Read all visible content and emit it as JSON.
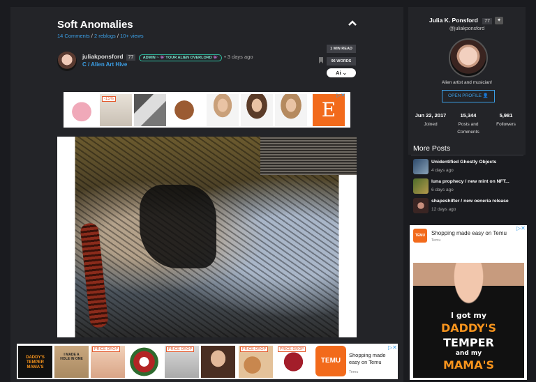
{
  "post": {
    "title": "Soft Anomalies",
    "comments": "14 Comments",
    "reblogs": "2 reblogs",
    "views": "10+ views",
    "author": "juliakponsford",
    "author_level": "77",
    "admin_badge": "ADMIN ~ 👾 YOUR ALIEN OVERLORD 👾",
    "time_ago": "• 3 days ago",
    "community": "C / Alien Art Hive",
    "read_time": "1 MIN READ",
    "word_count": "96 WORDS",
    "ai_label": "Ai"
  },
  "ad_top": {
    "discount": "-15%",
    "etsy_letter": "E"
  },
  "ad_bottom": {
    "price_drop": "PRICE DROP",
    "shirt_text": "DADDY'S TEMPER MAMA'S",
    "shirt_mini": "I MADE A HOLE IN ONE",
    "temu_text": "Shopping made easy on Temu",
    "temu_sub": "Temu",
    "temu_logo": "TEMU"
  },
  "sidebar": {
    "name": "Julia K. Ponsford",
    "level": "77",
    "handle": "@juliakponsford",
    "bio": "Alien artist and musician!",
    "open_profile": "OPEN PROFILE",
    "stats": [
      {
        "value": "Jun 22, 2017",
        "label": "Joined"
      },
      {
        "value": "15,344",
        "label": "Posts and Comments"
      },
      {
        "value": "5,981",
        "label": "Followers"
      }
    ],
    "more_posts_title": "More Posts",
    "more_posts": [
      {
        "title": "Unidentified Ghostly Objects",
        "time": "4 days ago"
      },
      {
        "title": "luna prophecy / new mint on NFT...",
        "time": "6 days ago"
      },
      {
        "title": "shapeshifter / new oeneria release",
        "time": "12 days ago"
      }
    ]
  },
  "ad_side": {
    "headline": "Shopping made easy on Temu",
    "brand": "Temu",
    "logo": "TEMU",
    "line1": "I got my",
    "line2": "DADDY'S",
    "line3": "TEMPER",
    "line4": "and my",
    "line5": "MAMA'S"
  },
  "colors": {
    "accent": "#3b9ee5",
    "admin": "#2ec4a6",
    "temu": "#f26a1b",
    "background": "#1a1b1f",
    "card": "#232428"
  }
}
